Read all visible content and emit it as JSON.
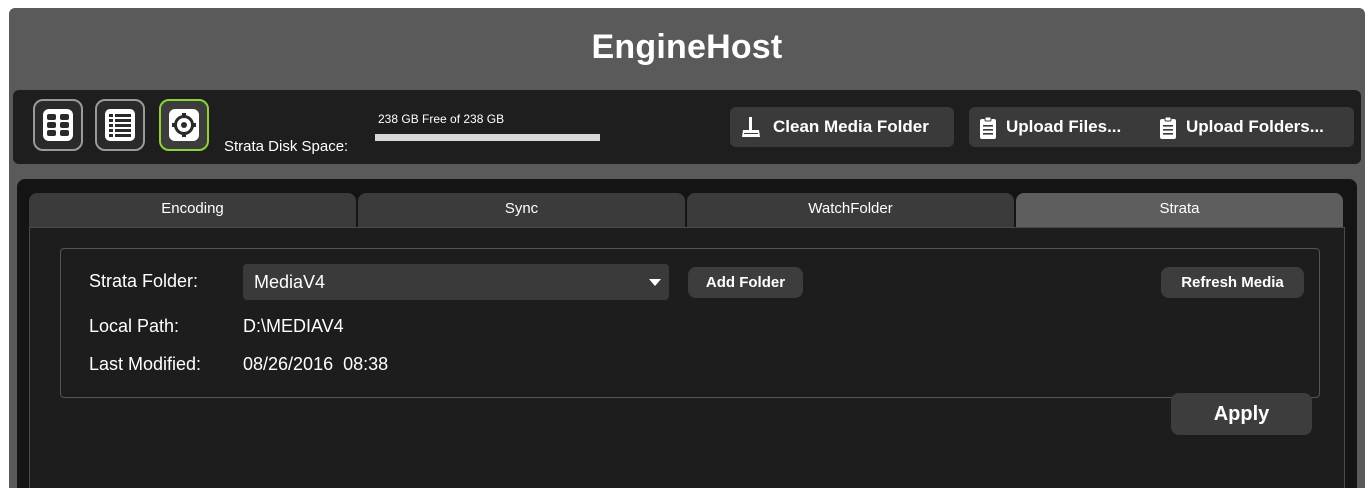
{
  "app": {
    "title": "EngineHost"
  },
  "toolbar": {
    "view_buttons": [
      {
        "name": "grid-view",
        "icon": "grid-icon"
      },
      {
        "name": "list-view",
        "icon": "list-icon"
      },
      {
        "name": "settings",
        "icon": "gear-icon",
        "active": true
      }
    ],
    "disk_label": "Strata Disk Space:",
    "disk_free_text": "238 GB Free of 238 GB",
    "disk_free_fraction": 1.0,
    "clean_label": "Clean Media Folder",
    "upload_files_label": "Upload Files...",
    "upload_folders_label": "Upload Folders..."
  },
  "tabs": [
    {
      "label": "Encoding",
      "active": false
    },
    {
      "label": "Sync",
      "active": false
    },
    {
      "label": "WatchFolder",
      "active": false
    },
    {
      "label": "Strata",
      "active": true
    }
  ],
  "strata": {
    "folder_label": "Strata Folder:",
    "folder_value": "MediaV4",
    "add_folder_label": "Add Folder",
    "refresh_label": "Refresh Media",
    "local_path_label": "Local Path:",
    "local_path_value": "D:\\MEDIAV4",
    "last_modified_label": "Last Modified:",
    "last_modified_value": "08/26/2016  08:38",
    "apply_label": "Apply"
  },
  "colors": {
    "accent_active": "#8ed13a",
    "window_bg": "#5a5a5a",
    "panel_bg": "#141414"
  }
}
